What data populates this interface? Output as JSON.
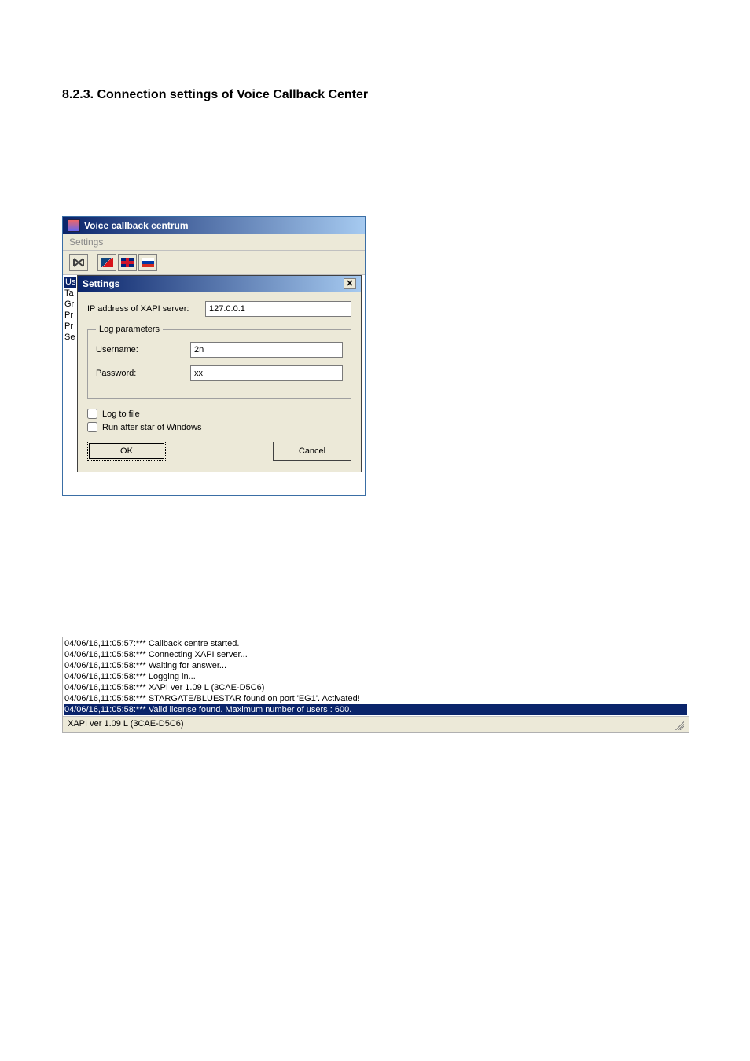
{
  "doc": {
    "heading": "8.2.3.  Connection settings of Voice Callback Center"
  },
  "app": {
    "title": "Voice callback centrum",
    "menu": {
      "settings": "Settings"
    },
    "side": {
      "l1": "Us",
      "l2": "Ta",
      "l3": "Gr",
      "l4": "Pr",
      "l5": "Pr",
      "l6": "Se"
    }
  },
  "dialog": {
    "title": "Settings",
    "ip_label": "IP address of XAPI server:",
    "ip_value": "127.0.0.1",
    "log_legend": "Log parameters",
    "username_label": "Username:",
    "username_value": "2n",
    "password_label": "Password:",
    "password_value": "xx",
    "log_to_file": "Log to file",
    "run_after_start": "Run after star of Windows",
    "ok": "OK",
    "cancel": "Cancel"
  },
  "log": {
    "lines": [
      "04/06/16,11:05:57:*** Callback centre started.",
      "04/06/16,11:05:58:*** Connecting XAPI server...",
      "04/06/16,11:05:58:*** Waiting for answer...",
      "04/06/16,11:05:58:*** Logging in...",
      "04/06/16,11:05:58:*** XAPI ver 1.09 L (3CAE-D5C6)",
      "04/06/16,11:05:58:*** STARGATE/BLUESTAR found on port 'EG1'. Activated!",
      "04/06/16,11:05:58:*** Valid license found. Maximum number of users : 600."
    ],
    "selected_index": 6,
    "status": "XAPI ver 1.09 L (3CAE-D5C6)"
  }
}
